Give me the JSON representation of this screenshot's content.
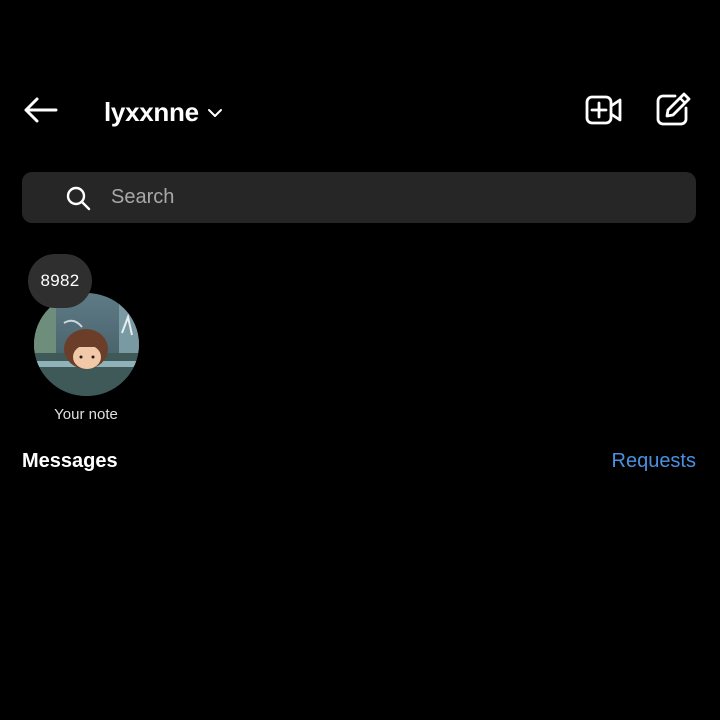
{
  "header": {
    "back_icon": "arrow-left-icon",
    "account_name": "lyxxnne",
    "account_switch_icon": "chevron-down-icon",
    "video_call_icon": "video-plus-icon",
    "compose_icon": "pencil-square-icon"
  },
  "search": {
    "icon": "search-icon",
    "placeholder": "Search",
    "value": ""
  },
  "notes": {
    "note_text": "8982",
    "label": "Your note",
    "avatar_icon": "avatar"
  },
  "messages": {
    "heading": "Messages",
    "requests_label": "Requests"
  },
  "colors": {
    "background": "#000000",
    "search_bg": "#262626",
    "link": "#4a90e2"
  }
}
